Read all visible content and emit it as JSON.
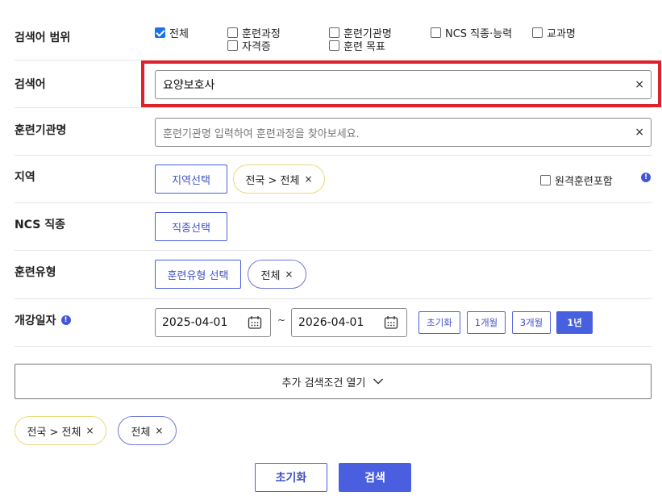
{
  "scope": {
    "label": "검색어 범위",
    "options": [
      {
        "label": "전체",
        "checked": true
      },
      {
        "label": "훈련과정",
        "checked": false
      },
      {
        "label": "훈련기관명",
        "checked": false
      },
      {
        "label": "NCS 직종·능력",
        "checked": false
      },
      {
        "label": "교과명",
        "checked": false
      },
      {
        "label": "자격증",
        "checked": false
      },
      {
        "label": "훈련 목표",
        "checked": false
      }
    ]
  },
  "keyword": {
    "label": "검색어",
    "value": "요양보호사",
    "clear": "×"
  },
  "institution": {
    "label": "훈련기관명",
    "placeholder": "훈련기관명 입력하여 훈련과정을 찾아보세요.",
    "clear": "×"
  },
  "region": {
    "label": "지역",
    "select_button": "지역선택",
    "chip": "전국 > 전체",
    "remote_label": "원격훈련포함",
    "remote_checked": false,
    "info_icon": "info-icon"
  },
  "ncs": {
    "label": "NCS 직종",
    "select_button": "직종선택"
  },
  "training_type": {
    "label": "훈련유형",
    "select_button": "훈련유형 선택",
    "chip": "전체"
  },
  "start_date": {
    "label": "개강일자",
    "from": "2025-04-01",
    "separator": "~",
    "to": "2026-04-01",
    "buttons": [
      "초기화",
      "1개월",
      "3개월",
      "1년"
    ],
    "active_button": "1년"
  },
  "expand": {
    "label": "추가 검색조건 열기"
  },
  "selected_chips": [
    "전국 > 전체",
    "전체"
  ],
  "chip_remove": "×",
  "actions": {
    "reset": "초기화",
    "search": "검색"
  },
  "colors": {
    "accent": "#4a5fe0",
    "highlight": "#e2202a",
    "chip_yellow_border": "#e9d97a"
  }
}
